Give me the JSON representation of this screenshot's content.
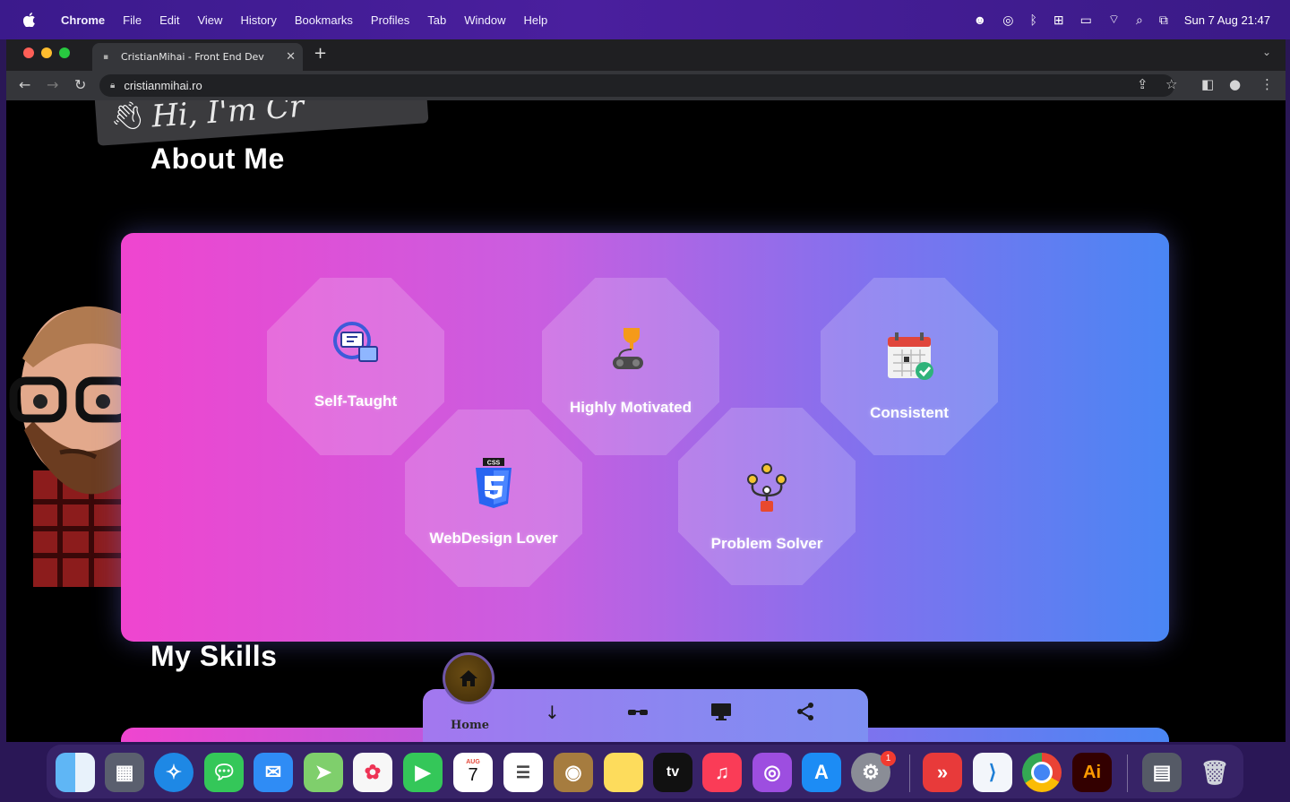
{
  "menubar": {
    "app_name": "Chrome",
    "items": [
      "File",
      "Edit",
      "View",
      "History",
      "Bookmarks",
      "Profiles",
      "Tab",
      "Window",
      "Help"
    ],
    "datetime": "Sun 7 Aug  21:47"
  },
  "browser": {
    "tab_title": "CristianMihai - Front End Dev",
    "url": "cristianmihai.ro"
  },
  "page": {
    "greeting": "Hi, I'm Cr",
    "about_title": "About Me",
    "skills_title": "My Skills",
    "traits": [
      {
        "label": "Self-Taught"
      },
      {
        "label": "Highly Motivated"
      },
      {
        "label": "Consistent"
      },
      {
        "label": "WebDesign Lover"
      },
      {
        "label": "Problem Solver"
      }
    ],
    "css_badge": "CSS"
  },
  "bottom_nav": {
    "home_label": "Home"
  },
  "dock": {
    "calendar_month": "AUG",
    "calendar_day": "7",
    "tv_label": "tv",
    "ai_label": "Ai",
    "settings_badge": "1"
  },
  "colors": {
    "card_gradient_start": "#ef45cf",
    "card_gradient_end": "#4a86f4",
    "menubar": "#3b1a8c"
  }
}
